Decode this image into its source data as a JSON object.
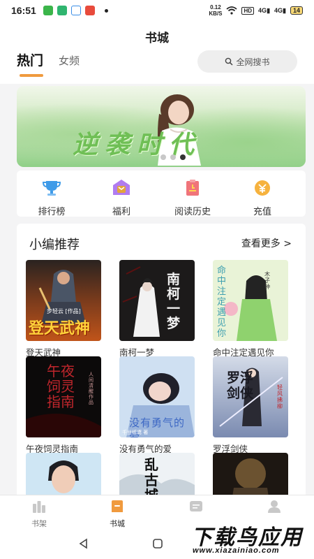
{
  "status_bar": {
    "time": "16:51",
    "net_speed_value": "0.12",
    "net_speed_unit": "KB/S",
    "hd": "HD",
    "signal_1": "4G",
    "signal_2": "4G",
    "battery": "14"
  },
  "header": {
    "title": "书城",
    "tabs": [
      {
        "label": "热门",
        "active": true
      },
      {
        "label": "女频",
        "active": false
      }
    ],
    "search_label": "全网搜书"
  },
  "banner": {
    "text": "逆袭时代",
    "dot_count": 3,
    "active_dot": 2
  },
  "quick_links": [
    {
      "label": "排行榜",
      "icon": "trophy-icon"
    },
    {
      "label": "福利",
      "icon": "gift-icon"
    },
    {
      "label": "阅读历史",
      "icon": "history-icon"
    },
    {
      "label": "充值",
      "icon": "recharge-icon"
    }
  ],
  "section": {
    "title": "小编推荐",
    "more_label": "查看更多 >",
    "books": [
      {
        "title": "登天武神",
        "cover_text": "登天武神",
        "cover_author": "步轻云 [作品]"
      },
      {
        "title": "南柯一梦",
        "cover_text": "南柯一梦"
      },
      {
        "title": "命中注定遇见你",
        "cover_text": "命中注定遇见你",
        "cover_author": "木子钟"
      },
      {
        "title": "午夜饲灵指南",
        "cover_text": "午夜饲灵指南",
        "cover_author": "人间清醒 作品"
      },
      {
        "title": "没有勇气的爱",
        "cover_text": "没有勇气的爱",
        "cover_author": "千丝纸鸢 著"
      },
      {
        "title": "罗浮剑侠",
        "cover_text": "罗浮剑侠",
        "cover_author": "轻风拂柳"
      },
      {
        "title": "",
        "cover_text": ""
      },
      {
        "title": "",
        "cover_text": "乱古城"
      },
      {
        "title": "",
        "cover_text": ""
      }
    ]
  },
  "bottom_nav": [
    {
      "label": "书架",
      "icon": "bookshelf-icon",
      "active": false
    },
    {
      "label": "书城",
      "icon": "bookstore-icon",
      "active": true
    },
    {
      "label": "",
      "icon": "message-icon",
      "active": false
    },
    {
      "label": "",
      "icon": "profile-icon",
      "active": false
    }
  ],
  "watermark": {
    "title": "下载鸟应用",
    "url": "www.xiazainiao.com"
  },
  "colors": {
    "accent": "#f09a3e",
    "background": "#f4f4f5"
  }
}
